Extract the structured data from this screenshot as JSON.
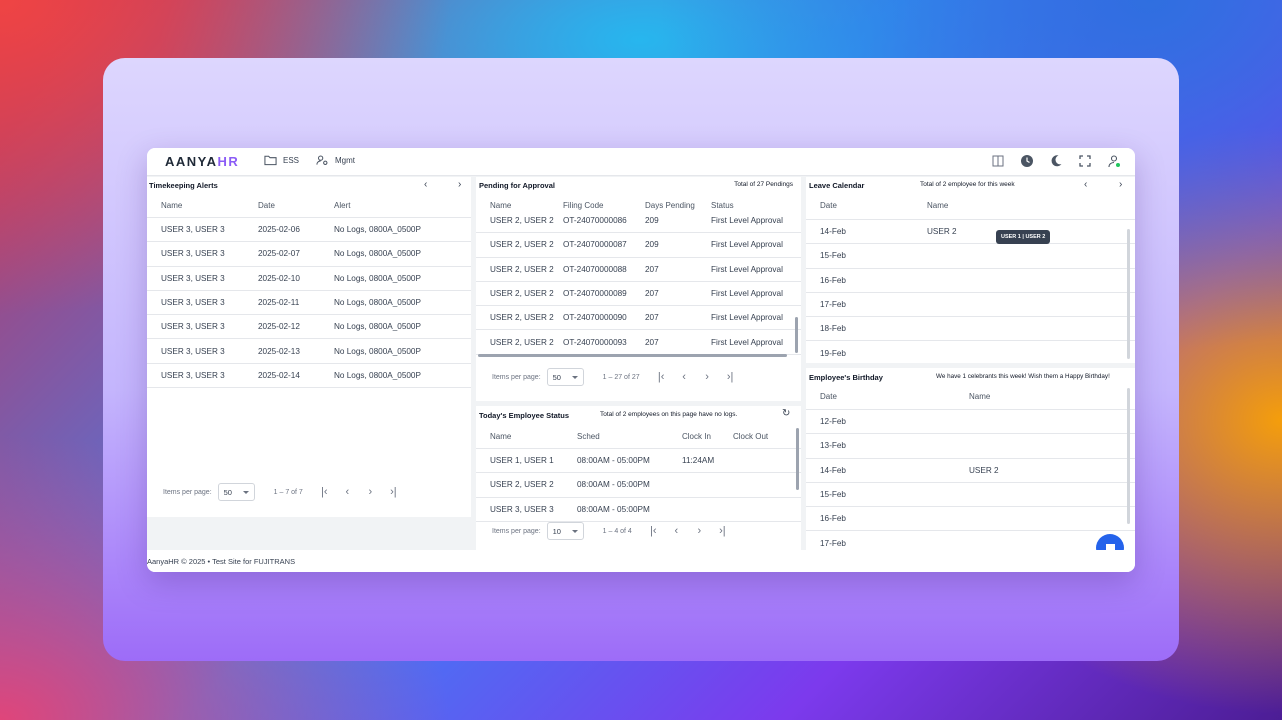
{
  "app": {
    "logo_main": "AANYA",
    "logo_accent": "HR"
  },
  "nav": [
    {
      "label": "ESS",
      "icon": "folder-icon"
    },
    {
      "label": "Mgmt",
      "icon": "user-gear-icon"
    }
  ],
  "toolbar_icons": [
    "sidebar-toggle-icon",
    "clock-icon",
    "dark-mode-icon",
    "fullscreen-icon",
    "user-icon"
  ],
  "timekeeping": {
    "title": "Timekeeping Alerts",
    "headers": [
      "Name",
      "Date",
      "Alert"
    ],
    "rows": [
      [
        "USER 3, USER 3",
        "2025-02-06",
        "No Logs, 0800A_0500P"
      ],
      [
        "USER 3, USER 3",
        "2025-02-07",
        "No Logs, 0800A_0500P"
      ],
      [
        "USER 3, USER 3",
        "2025-02-10",
        "No Logs, 0800A_0500P"
      ],
      [
        "USER 3, USER 3",
        "2025-02-11",
        "No Logs, 0800A_0500P"
      ],
      [
        "USER 3, USER 3",
        "2025-02-12",
        "No Logs, 0800A_0500P"
      ],
      [
        "USER 3, USER 3",
        "2025-02-13",
        "No Logs, 0800A_0500P"
      ],
      [
        "USER 3, USER 3",
        "2025-02-14",
        "No Logs, 0800A_0500P"
      ]
    ],
    "pager": {
      "label": "Items per page:",
      "size": "50",
      "range": "1 – 7 of 7"
    }
  },
  "pending": {
    "title": "Pending for Approval",
    "note": "Total of 27 Pendings",
    "headers": [
      "Name",
      "Filing Code",
      "Days Pending",
      "Status"
    ],
    "rows": [
      [
        "USER 2, USER 2",
        "OT-24070000086",
        "209",
        "First Level Approval"
      ],
      [
        "USER 2, USER 2",
        "OT-24070000087",
        "209",
        "First Level Approval"
      ],
      [
        "USER 2, USER 2",
        "OT-24070000088",
        "207",
        "First Level Approval"
      ],
      [
        "USER 2, USER 2",
        "OT-24070000089",
        "207",
        "First Level Approval"
      ],
      [
        "USER 2, USER 2",
        "OT-24070000090",
        "207",
        "First Level Approval"
      ],
      [
        "USER 2, USER 2",
        "OT-24070000093",
        "207",
        "First Level Approval"
      ]
    ],
    "pager": {
      "label": "Items per page:",
      "size": "50",
      "range": "1 – 27 of 27"
    }
  },
  "status": {
    "title": "Today's Employee Status",
    "note": "Total of 2 employees on this page have no logs.",
    "headers": [
      "Name",
      "Sched",
      "Clock In",
      "Clock Out"
    ],
    "rows": [
      [
        "USER 1, USER 1",
        "08:00AM - 05:00PM",
        "11:24AM",
        ""
      ],
      [
        "USER 2, USER 2",
        "08:00AM - 05:00PM",
        "",
        ""
      ],
      [
        "USER 3, USER 3",
        "08:00AM - 05:00PM",
        "",
        ""
      ]
    ],
    "pager": {
      "label": "Items per page:",
      "size": "10",
      "range": "1 – 4 of 4"
    }
  },
  "leave": {
    "title": "Leave Calendar",
    "note": "Total of 2 employee for this week",
    "headers": [
      "Date",
      "Name"
    ],
    "rows": [
      [
        "14-Feb",
        "USER 2"
      ],
      [
        "15-Feb",
        ""
      ],
      [
        "16-Feb",
        ""
      ],
      [
        "17-Feb",
        ""
      ],
      [
        "18-Feb",
        ""
      ],
      [
        "19-Feb",
        ""
      ]
    ],
    "tooltip": "USER 1 | USER 2"
  },
  "birthday": {
    "title": "Employee's Birthday",
    "note": "We have 1 celebrants this week! Wish them a Happy Birthday!",
    "headers": [
      "Date",
      "Name"
    ],
    "rows": [
      [
        "12-Feb",
        ""
      ],
      [
        "13-Feb",
        ""
      ],
      [
        "14-Feb",
        "USER 2"
      ],
      [
        "15-Feb",
        ""
      ],
      [
        "16-Feb",
        ""
      ],
      [
        "17-Feb",
        ""
      ]
    ]
  },
  "footer": {
    "text": "AanyaHR © 2025 • Test Site for FUJITRANS"
  },
  "colors": {
    "accent": "#8b5cf6",
    "chat": "#2563eb"
  }
}
